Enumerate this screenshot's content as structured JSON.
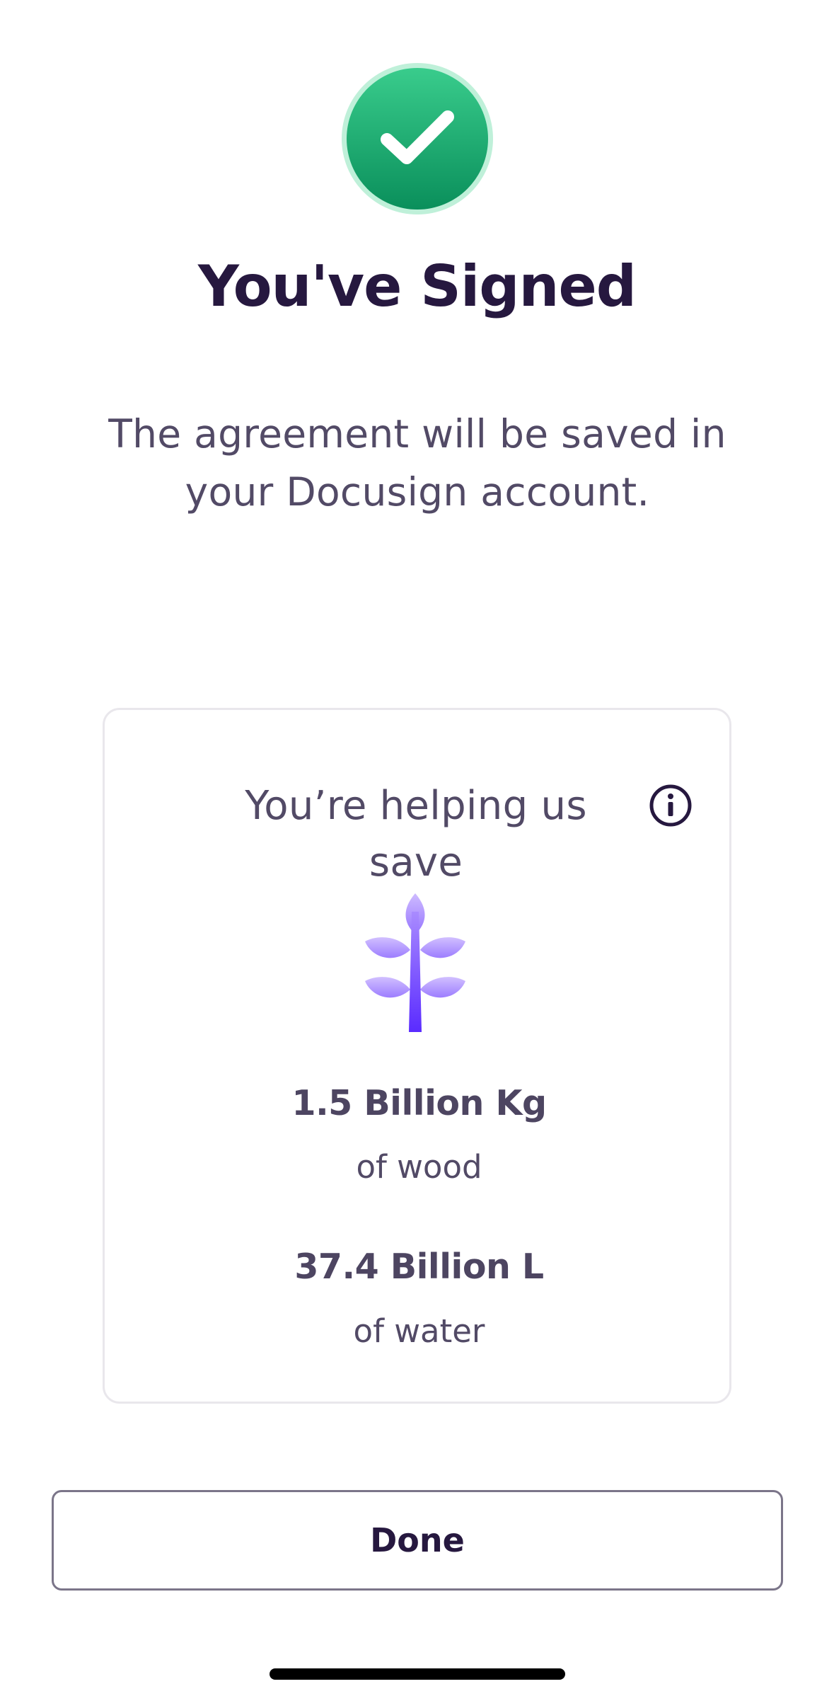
{
  "header": {
    "title": "You've Signed",
    "subtitle": "The agreement will be saved in your Docusign account.",
    "badge_icon": "checkmark-icon"
  },
  "savings_card": {
    "heading": "You’re helping us save",
    "info_icon": "info-icon",
    "illustration_icon": "plant-icon",
    "stats": [
      {
        "value": "1.5 Billion Kg",
        "label": "of wood"
      },
      {
        "value": "37.4 Billion L",
        "label": "of water"
      }
    ]
  },
  "actions": {
    "done_label": "Done"
  },
  "colors": {
    "success_green": "#1fae73",
    "title_text": "#26183f",
    "body_text": "#524a66",
    "plant_purple": "#6b3cff"
  }
}
